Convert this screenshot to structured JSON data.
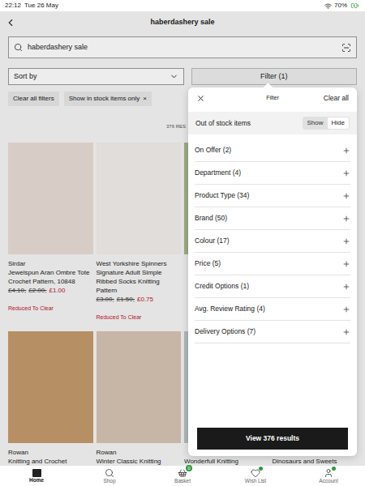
{
  "status_bar": {
    "time": "22:12",
    "date": "Tue 26 May",
    "battery": "70%"
  },
  "header": {
    "title": "haberdashery sale"
  },
  "search": {
    "value": "haberdashery sale"
  },
  "sort": {
    "label": "Sort by"
  },
  "filter_button": {
    "label": "Filter (1)"
  },
  "chips": [
    {
      "label": "Clear all filters"
    },
    {
      "label": "Show in stock items only",
      "close": "×"
    }
  ],
  "results": {
    "count": "376 RES"
  },
  "products": [
    {
      "brand": "Sirdar",
      "name": "Jewelspun Aran Ombre Tote Crochet Pattern, 10848",
      "was": [
        "£4.10,",
        "£2.00,"
      ],
      "now": "£1.00",
      "tag": "Reduced To Clear",
      "color": "#e9dcd6"
    },
    {
      "brand": "West Yorkshire Spinners",
      "name": "Signature Adult Simple Ribbed Socks Knitting Pattern",
      "was": [
        "£3.00,",
        "£1.50,"
      ],
      "now": "£0.75",
      "tag": "Reduced To Clear",
      "color": "#f1eeeb"
    },
    {
      "color": "#a7b98f"
    },
    {
      "color": "#d8d2c8"
    },
    {
      "brand": "Rowan",
      "name": "Knitting and Crochet",
      "color": "#c49a6c"
    },
    {
      "brand": "Rowan",
      "name": "Winter Classic Knitting",
      "color": "#d7c3b3"
    },
    {
      "name": "Wonderfull Knitting",
      "color": "#b9c4cc"
    },
    {
      "name": "Dinosaurs and Sweets",
      "color": "#cfd8c4"
    }
  ],
  "filter_panel": {
    "title": "Filter",
    "clear": "Clear all",
    "stock": {
      "label": "Out of stock items",
      "options": [
        {
          "label": "Show",
          "selected": false
        },
        {
          "label": "Hide",
          "selected": true
        }
      ]
    },
    "groups": [
      {
        "label": "On Offer (2)",
        "expanded": false
      },
      {
        "label": "Department (4)",
        "expanded": false
      },
      {
        "label": "Product Type (34)",
        "expanded": false
      },
      {
        "label": "Brand (50)",
        "expanded": false
      },
      {
        "label": "Colour (17)",
        "expanded": false
      },
      {
        "label": "Price (5)",
        "expanded": false
      },
      {
        "label": "Credit Options (1)",
        "expanded": false
      },
      {
        "label": "Avg. Review Rating (4)",
        "expanded": false
      },
      {
        "label": "Delivery Options (7)",
        "expanded": false
      }
    ],
    "cta": "View 376 results"
  },
  "nav": [
    {
      "label": "Home",
      "selected": true,
      "dot": false
    },
    {
      "label": "Shop",
      "selected": false,
      "dot": false
    },
    {
      "label": "Basket",
      "selected": false,
      "dot": false,
      "badge": "0"
    },
    {
      "label": "Wish List",
      "selected": false,
      "dot": true
    },
    {
      "label": "Account",
      "selected": false,
      "dot": true
    }
  ]
}
